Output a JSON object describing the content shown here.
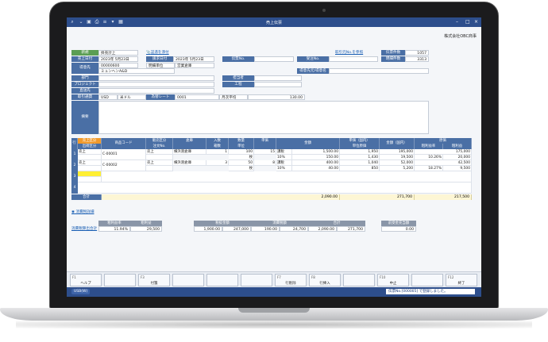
{
  "window": {
    "title": "売上伝票",
    "company": "株式会社OBC商事"
  },
  "header": {
    "kind_label": "新規",
    "kind_value": "掛売計上",
    "attach_link": "証憑を添付",
    "sales_date_label": "売上日付",
    "sales_date": "2023年 5月23日",
    "invoice_date_label": "請求日付",
    "invoice_date": "2023年 5月23日",
    "slip_no_label": "伝票No.",
    "order_no_label": "受注No.",
    "ref_link": "取引元No.を参照",
    "slip_count_label": "伝票件数",
    "slip_count": "1057",
    "detail_count_label": "明細件数",
    "detail_count": "3313",
    "customer_label": "得意先",
    "customer_code": "00000600",
    "customer_name": "ミュンヘンA&D",
    "unit_label": "明細単位",
    "warehouse_label": "営業倉庫",
    "billing_label": "得意先元/得意名",
    "dept_label": "部門",
    "staff_label": "担当者",
    "project_label": "プロジェクト",
    "process_label": "工程",
    "delivery_label": "直送先",
    "currency_label": "取引通貨",
    "currency": "USD",
    "currency_name": "米ドル",
    "rate_type_label": "為替レート",
    "rate_type": "0001",
    "rate_name": "月次平均",
    "rate": "130.00",
    "memo_label": "摘要"
  },
  "grid": {
    "headers_top": [
      "行",
      "売上区分",
      "商品コード",
      "販売区分",
      "倉庫",
      "入数",
      "数量",
      "単価",
      "",
      "単価（国内）",
      "金額（国内）",
      "原価"
    ],
    "headers_bottom": [
      "",
      "出荷区分",
      "",
      "注文No.",
      "",
      "箱数",
      "単位",
      "",
      "金額",
      "単位原価",
      "",
      "粗利益率",
      "粗利益"
    ],
    "rows": [
      {
        "no": "1",
        "kind": "売上",
        "code": "C-00001",
        "sales": "売上",
        "wh": "横浜港倉庫",
        "qty_per": "1",
        "qty": "100",
        "unit": "枚",
        "price": "15",
        "tax": "課税",
        "tax_rate": "10%",
        "amount1": "1,500.00",
        "amount2": "150.00",
        "jp_price": "1,950",
        "jp_unit_cost": "1,430",
        "jp_amount": "195,000",
        "cost": "175,000",
        "margin_rate": "10.26%",
        "margin": "20,000",
        "jp_amount2": "19,500"
      },
      {
        "no": "2",
        "kind": "売上",
        "code": "C-00002",
        "sales": "売上",
        "wh": "横浜港倉庫",
        "qty_per": "3",
        "qty": "50",
        "unit": "枚",
        "price": "8",
        "tax": "課税",
        "tax_rate": "10%",
        "amount1": "400.00",
        "amount2": "40.00",
        "jp_price": "1,040",
        "jp_unit_cost": "850",
        "jp_amount": "52,000",
        "cost": "42,500",
        "margin_rate": "18.27%",
        "margin": "9,500",
        "jp_amount2": "5,200"
      }
    ],
    "row_nos": [
      "3",
      "4"
    ],
    "total_label": "合計",
    "total_amount": "2,090.00",
    "total_jp": "271,700",
    "total_cost": "217,500"
  },
  "summary": {
    "link": "消費税詳細",
    "row_label": "消費税算出合計",
    "h_margin_rate": "粗利益率",
    "h_margin": "粗利益",
    "h_tax_amount": "税抜金額",
    "h_tax": "消費税額",
    "h_total": "合計",
    "h_prev": "前受金充当額",
    "margin_rate": "11.94%",
    "margin": "29,500",
    "tax_base_usd": "1,900.00",
    "tax_base_jp": "247,000",
    "tax_usd": "190.00",
    "tax_jp": "24,700",
    "total_usd": "2,090.00",
    "total_jp": "271,700",
    "prev": "0.00"
  },
  "fkeys": [
    {
      "n": "F1",
      "t": "ヘルプ"
    },
    {
      "n": "",
      "t": ""
    },
    {
      "n": "F3",
      "t": "付箋"
    },
    {
      "n": "",
      "t": ""
    },
    {
      "n": "",
      "t": ""
    },
    {
      "n": "",
      "t": ""
    },
    {
      "n": "F7",
      "t": "行削除"
    },
    {
      "n": "F8",
      "t": "行挿入"
    },
    {
      "n": "",
      "t": ""
    },
    {
      "n": "F10",
      "t": "中止"
    },
    {
      "n": "",
      "t": ""
    },
    {
      "n": "F12",
      "t": "終了"
    }
  ],
  "status": {
    "left": "USB(W)",
    "right": "伝票No.[000005] で登録しました。"
  }
}
